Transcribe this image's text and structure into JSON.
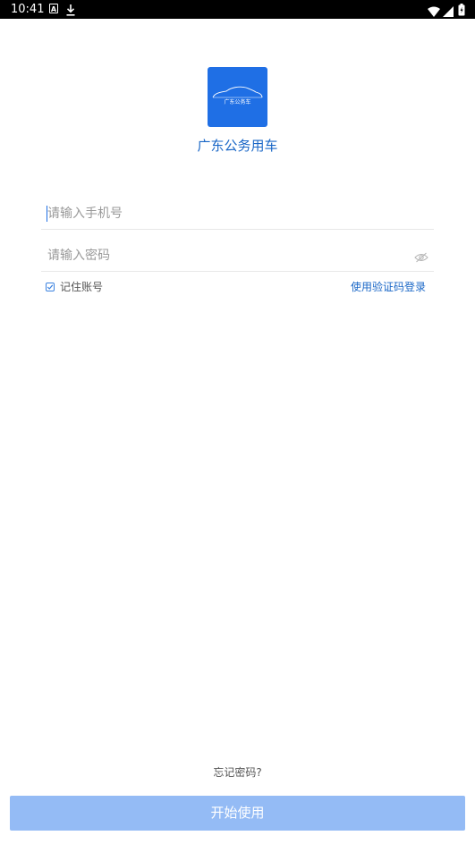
{
  "status_bar": {
    "time": "10:41",
    "notification_icons": [
      "a-icon",
      "download-icon"
    ],
    "system_icons": [
      "wifi-icon",
      "signal-icon",
      "battery-icon"
    ]
  },
  "app": {
    "logo_text": "广东公务车",
    "name": "广东公务用车",
    "brand_color": "#1f6fe5"
  },
  "form": {
    "phone": {
      "value": "",
      "placeholder": "请输入手机号"
    },
    "password": {
      "value": "",
      "placeholder": "请输入密码",
      "visibility_icon": "eye-icon"
    },
    "remember": {
      "label": "记住账号",
      "checked": true
    },
    "sms_login_label": "使用验证码登录"
  },
  "footer": {
    "forgot_password_label": "忘记密码?",
    "start_button_label": "开始使用",
    "start_button_color": "#94bbf5"
  }
}
